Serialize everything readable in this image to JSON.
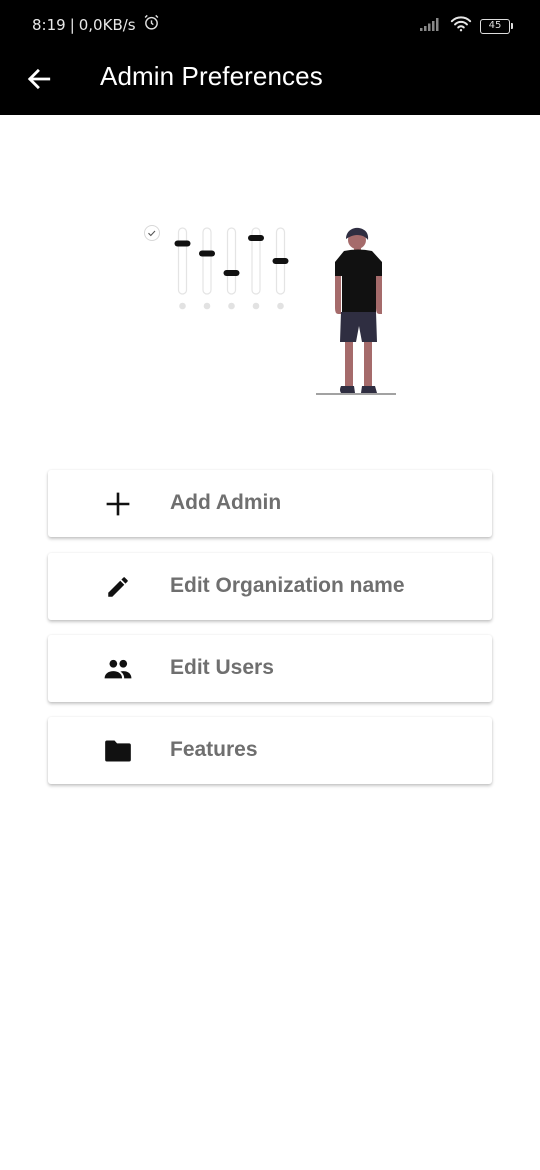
{
  "status_bar": {
    "time": "8:19",
    "separator": "|",
    "network_speed": "0,0KB/s",
    "battery_level": "45",
    "icons": [
      "alarm-icon",
      "signal-icon",
      "wifi-icon",
      "battery-icon"
    ]
  },
  "app_bar": {
    "title": "Admin Preferences",
    "back_icon": "arrow-back-icon"
  },
  "menu": {
    "items": [
      {
        "label": "Add Admin",
        "icon": "add-icon"
      },
      {
        "label": "Edit Organization name",
        "icon": "edit-pencil-icon"
      },
      {
        "label": "Edit Users",
        "icon": "people-icon"
      },
      {
        "label": "Features",
        "icon": "folder-icon"
      }
    ]
  },
  "colors": {
    "app_bar_bg": "#000000",
    "background": "#ffffff",
    "menu_label": "#6f6f6f",
    "icon": "#111111"
  }
}
